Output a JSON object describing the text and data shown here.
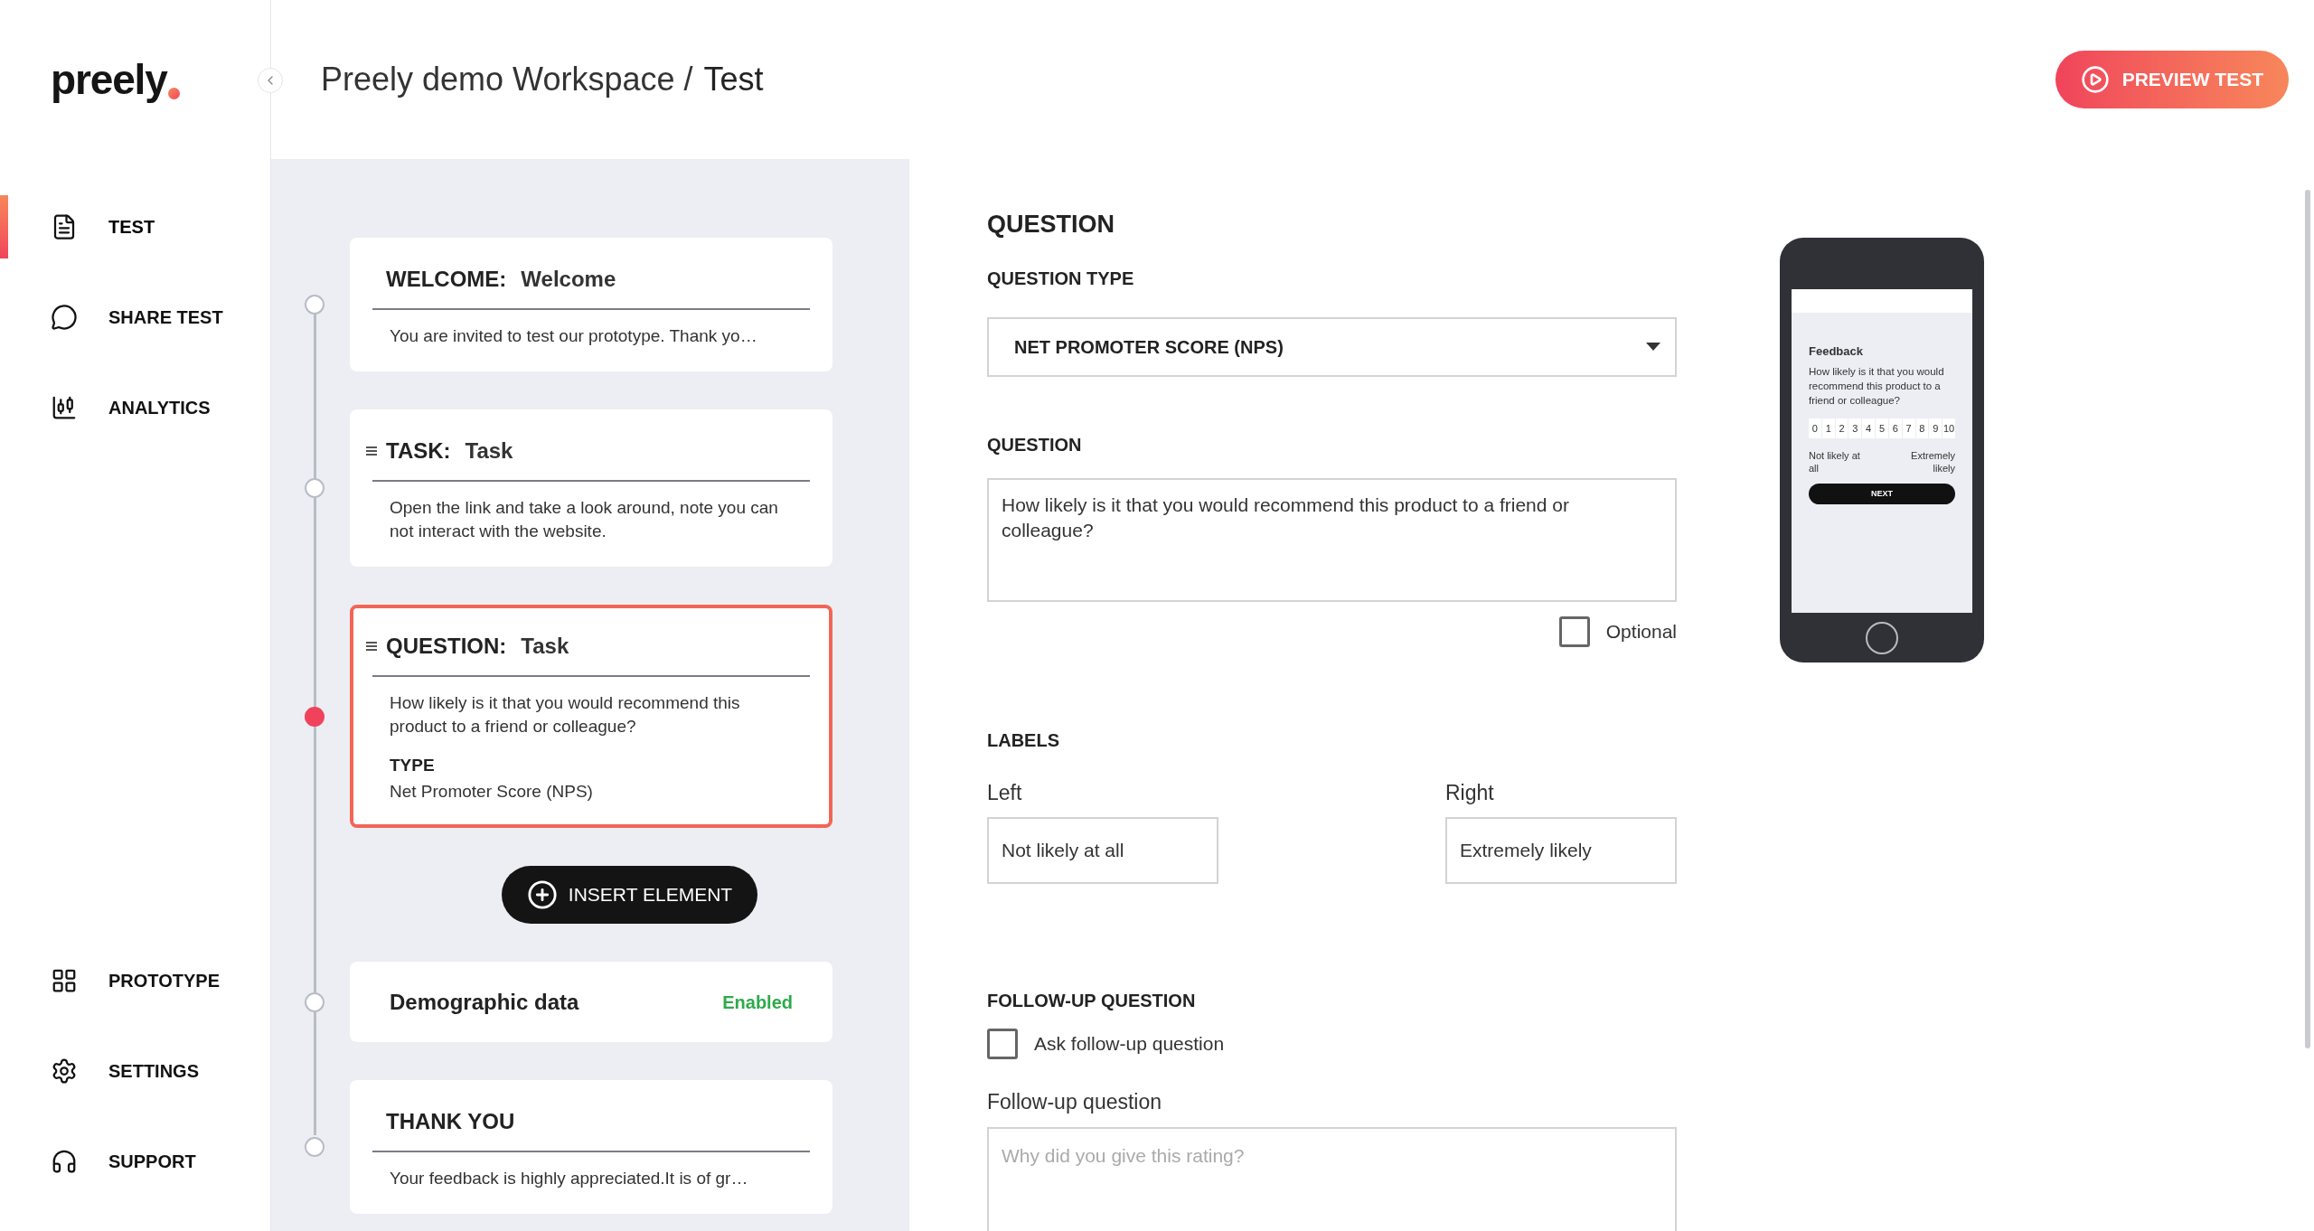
{
  "sidebar": {
    "logo": "preely",
    "top_items": [
      {
        "label": "TEST",
        "selected": true
      },
      {
        "label": "SHARE TEST",
        "selected": false
      },
      {
        "label": "ANALYTICS",
        "selected": false
      }
    ],
    "bottom_items": [
      {
        "label": "PROTOTYPE",
        "selected": false
      },
      {
        "label": "SETTINGS",
        "selected": false
      },
      {
        "label": "SUPPORT",
        "selected": false
      }
    ]
  },
  "header": {
    "workspace": "Preely demo Workspace /",
    "test": "Test",
    "preview_button": "PREVIEW TEST"
  },
  "elements": [
    {
      "kind": "card",
      "type_label": "WELCOME:",
      "name": "Welcome",
      "body": "You are invited to test our prototype. Thank yo…",
      "draggable": false,
      "selected": false
    },
    {
      "kind": "card",
      "type_label": "TASK:",
      "name": "Task",
      "body": "Open the link and take a look around, note you can not interact with the website.",
      "draggable": true,
      "selected": false
    },
    {
      "kind": "card",
      "type_label": "QUESTION:",
      "name": "Task",
      "body": "How likely is it that you would recommend this product to a friend or colleague?",
      "detail_label": "TYPE",
      "detail_value": "Net Promoter Score (NPS)",
      "draggable": true,
      "selected": true
    },
    {
      "kind": "insert",
      "label": "INSERT ELEMENT"
    },
    {
      "kind": "toggle",
      "name": "Demographic data",
      "status": "Enabled"
    },
    {
      "kind": "card",
      "type_label": "THANK YOU",
      "body": "Your feedback is highly appreciated.It is of gr…",
      "draggable": false,
      "selected": false
    }
  ],
  "editor": {
    "heading": "QUESTION",
    "question_type": {
      "label": "QUESTION TYPE",
      "value": "NET PROMOTER SCORE (NPS)"
    },
    "question": {
      "label": "QUESTION",
      "value": "How likely is it that you would recommend this product to a friend or colleague?"
    },
    "optional": {
      "label": "Optional",
      "checked": false
    },
    "labels": {
      "heading": "LABELS",
      "left": {
        "label": "Left",
        "value": "Not likely at all"
      },
      "right": {
        "label": "Right",
        "value": "Extremely likely"
      }
    },
    "follow_up": {
      "heading": "FOLLOW-UP QUESTION",
      "checkbox": {
        "label": "Ask follow-up question",
        "checked": false
      },
      "field_label": "Follow-up question",
      "placeholder": "Why did you give this rating?"
    }
  },
  "preview": {
    "title": "Feedback",
    "question": "How likely is it that you would recommend this product to a friend or colleague?",
    "scale": [
      "0",
      "1",
      "2",
      "3",
      "4",
      "5",
      "6",
      "7",
      "8",
      "9",
      "10"
    ],
    "left_label": "Not likely at all",
    "right_label": "Extremely likely",
    "button": "NEXT"
  }
}
